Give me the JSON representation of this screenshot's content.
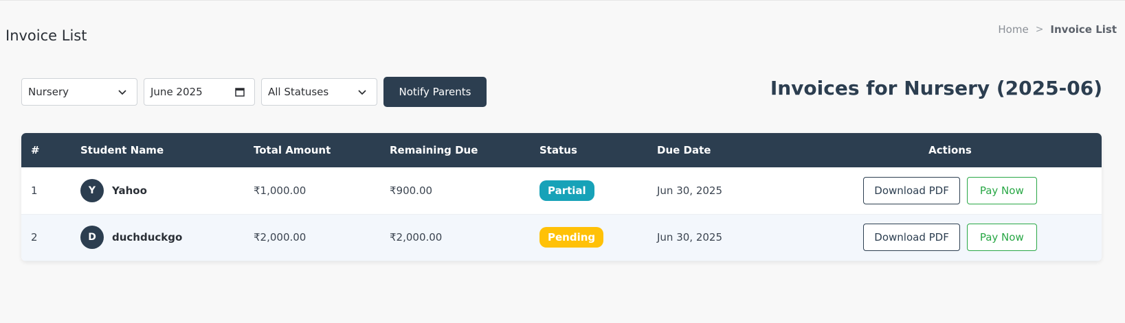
{
  "header": {
    "title": "Invoice List",
    "breadcrumb": {
      "home": "Home",
      "current": "Invoice List"
    }
  },
  "filters": {
    "class_value": "Nursery",
    "month_value": "June 2025",
    "status_value": "All Statuses",
    "notify_label": "Notify Parents"
  },
  "section_title": "Invoices for Nursery (2025-06)",
  "table": {
    "headers": [
      "#",
      "Student Name",
      "Total Amount",
      "Remaining Due",
      "Status",
      "Due Date",
      "Actions"
    ],
    "rows": [
      {
        "num": "1",
        "initial": "Y",
        "name": "Yahoo",
        "total": "₹1,000.00",
        "due": "₹900.00",
        "status": "Partial",
        "due_date": "Jun 30, 2025",
        "download_label": "Download PDF",
        "pay_label": "Pay Now"
      },
      {
        "num": "2",
        "initial": "D",
        "name": "duchduckgo",
        "total": "₹2,000.00",
        "due": "₹2,000.00",
        "status": "Pending",
        "due_date": "Jun 30, 2025",
        "download_label": "Download PDF",
        "pay_label": "Pay Now"
      }
    ]
  },
  "colors": {
    "primary": "#2c3e50",
    "partial": "#17a2b8",
    "pending": "#ffc107",
    "pay": "#28a745"
  },
  "icons": [
    "chevron-down-icon",
    "calendar-icon",
    "chevron-right-icon"
  ]
}
